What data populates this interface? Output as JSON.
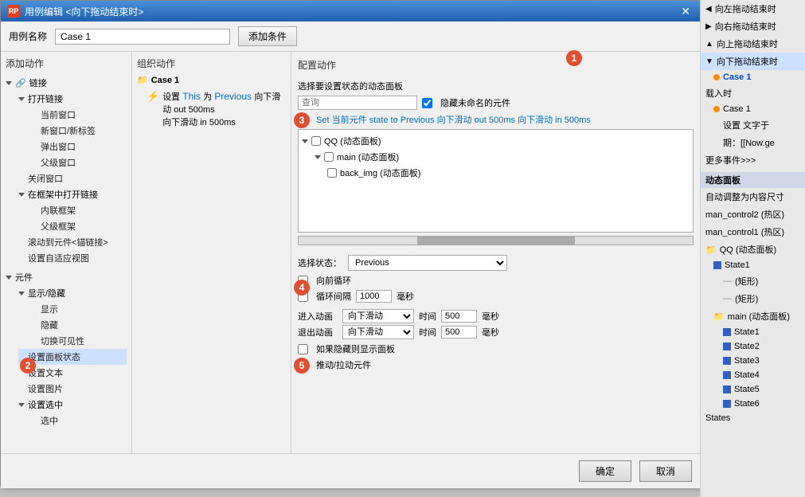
{
  "window": {
    "title": "用例编辑 <向下拖动结束时>",
    "title_icon": "RP"
  },
  "toolbar": {
    "case_label": "用例名称",
    "case_value": "Case 1",
    "add_condition_btn": "添加条件"
  },
  "panels": {
    "add_action": "添加动作",
    "organize_action": "组织动作",
    "config_action": "配置动作"
  },
  "left_tree": {
    "items": [
      {
        "label": "链接",
        "level": 0,
        "expanded": true
      },
      {
        "label": "打开链接",
        "level": 1,
        "expanded": true
      },
      {
        "label": "当前窗口",
        "level": 2
      },
      {
        "label": "新窗口/新标签",
        "level": 2
      },
      {
        "label": "弹出窗口",
        "level": 2
      },
      {
        "label": "父级窗口",
        "level": 2
      },
      {
        "label": "关闭窗口",
        "level": 1
      },
      {
        "label": "在框架中打开链接",
        "level": 1,
        "expanded": true
      },
      {
        "label": "内联框架",
        "level": 2
      },
      {
        "label": "父级框架",
        "level": 2
      },
      {
        "label": "滚动到元件<锚链接>",
        "level": 1
      },
      {
        "label": "设置自适应视图",
        "level": 1
      },
      {
        "label": "元件",
        "level": 0,
        "expanded": true
      },
      {
        "label": "显示/隐藏",
        "level": 1,
        "expanded": true
      },
      {
        "label": "显示",
        "level": 2
      },
      {
        "label": "隐藏",
        "level": 2
      },
      {
        "label": "切换可见性",
        "level": 2
      },
      {
        "label": "设置面板状态",
        "level": 1,
        "highlighted": true
      },
      {
        "label": "设置文本",
        "level": 1
      },
      {
        "label": "设置图片",
        "level": 1
      },
      {
        "label": "设置选中",
        "level": 1,
        "expanded": true
      },
      {
        "label": "选中",
        "level": 2
      }
    ]
  },
  "mid_panel": {
    "case_name": "Case 1",
    "action_text": "设置 This 为 Previous 向下滑动 out 500ms 向下滑动 in 500ms",
    "action_highlight_parts": [
      "This",
      "Previous",
      "向下滑动 out 500ms",
      "向下滑动 in 500ms"
    ]
  },
  "config": {
    "select_panel_title": "选择要设置状态的动态面板",
    "search_placeholder": "查询",
    "hide_unnamed_label": "隐藏未命名的元件",
    "set_state_label": "Set 当前元件 state to Previous 向下滑动 out 500ms 向下滑动 in 500ms",
    "tree_nodes": [
      {
        "label": "QQ (动态面板)",
        "level": 0
      },
      {
        "label": "main (动态面板)",
        "level": 1
      },
      {
        "label": "back_img (动态面板)",
        "level": 2
      }
    ],
    "select_state_label": "选择状态：",
    "state_value": "Previous",
    "forward_loop_label": "向前循环",
    "loop_interval_label": "循环间隔",
    "loop_interval_value": "1000",
    "loop_unit": "毫秒",
    "enter_anim_label": "进入动画",
    "enter_anim_value": "向下滑动",
    "enter_time_value": "500",
    "enter_unit": "毫秒",
    "exit_anim_label": "退出动画",
    "exit_anim_value": "向下滑动",
    "exit_time_value": "500",
    "exit_unit": "毫秒",
    "show_if_hidden_label": "如果隐藏则显示面板",
    "push_pull_label": "推动/拉动元件"
  },
  "buttons": {
    "ok": "确定",
    "cancel": "取消"
  },
  "right_sidebar": {
    "items": [
      {
        "label": "向左拖动结束时",
        "level": 0
      },
      {
        "label": "向右拖动结束时",
        "level": 0
      },
      {
        "label": "向上拖动结束时",
        "level": 0
      },
      {
        "label": "向下拖动结束时",
        "level": 0,
        "highlighted": true
      },
      {
        "label": "Case 1",
        "level": 1,
        "bold": true
      },
      {
        "label": "载入时",
        "level": 0
      },
      {
        "label": "Case 1",
        "level": 1
      },
      {
        "label": "设置 文字于 期：[[Now.ge",
        "level": 2
      },
      {
        "label": "更多事件>>>",
        "level": 0
      },
      {
        "label": "动态面板",
        "section": true
      },
      {
        "label": "自动调整为内容尺寸",
        "level": 0
      },
      {
        "label": "man_control2 (热区)",
        "level": 0
      },
      {
        "label": "man_control1 (热区)",
        "level": 0
      },
      {
        "label": "QQ (动态面板)",
        "level": 0
      },
      {
        "label": "State1",
        "level": 1
      },
      {
        "label": "(矩形)",
        "level": 2
      },
      {
        "label": "(矩形)",
        "level": 2
      },
      {
        "label": "main (动态面板)",
        "level": 1
      },
      {
        "label": "State1",
        "level": 2
      },
      {
        "label": "State2",
        "level": 2
      },
      {
        "label": "State3",
        "level": 2
      },
      {
        "label": "State4",
        "level": 2
      },
      {
        "label": "State5",
        "level": 2
      },
      {
        "label": "State6",
        "level": 2
      },
      {
        "label": "States",
        "level": 0,
        "bold": true
      }
    ]
  },
  "circle_numbers": [
    "1",
    "2",
    "3",
    "4",
    "5"
  ]
}
